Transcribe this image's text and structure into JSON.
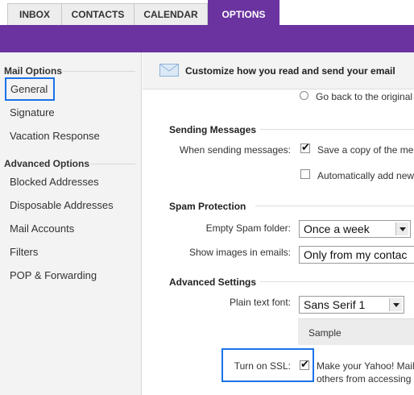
{
  "tabs": [
    {
      "label": "INBOX"
    },
    {
      "label": "CONTACTS"
    },
    {
      "label": "CALENDAR"
    },
    {
      "label": "OPTIONS"
    }
  ],
  "sidebar": {
    "mail_options_heading": "Mail Options",
    "mail_items": [
      {
        "label": "General"
      },
      {
        "label": "Signature"
      },
      {
        "label": "Vacation Response"
      }
    ],
    "advanced_heading": "Advanced Options",
    "advanced_items": [
      {
        "label": "Blocked Addresses"
      },
      {
        "label": "Disposable Addresses"
      },
      {
        "label": "Mail Accounts"
      },
      {
        "label": "Filters"
      },
      {
        "label": "POP & Forwarding"
      }
    ]
  },
  "header": {
    "title": "Customize how you read and send your email"
  },
  "main": {
    "go_back_radio_label": "Go back to the original",
    "sending": {
      "title": "Sending Messages",
      "label": "When sending messages:",
      "save_copy_label": "Save a copy of the me",
      "auto_add_label": "Automatically add new"
    },
    "spam": {
      "title": "Spam Protection",
      "empty_label": "Empty Spam folder:",
      "empty_value": "Once a week",
      "images_label": "Show images in emails:",
      "images_value": "Only from my contac"
    },
    "advanced": {
      "title": "Advanced Settings",
      "font_label": "Plain text font:",
      "font_value": "Sans Serif 1",
      "sample": "Sample",
      "ssl_label": "Turn on SSL:",
      "ssl_text_line1": "Make your Yahoo! Mail",
      "ssl_text_line2": "others from accessing"
    }
  },
  "colors": {
    "accent": "#6a33a0",
    "highlight": "#1a73e8"
  }
}
